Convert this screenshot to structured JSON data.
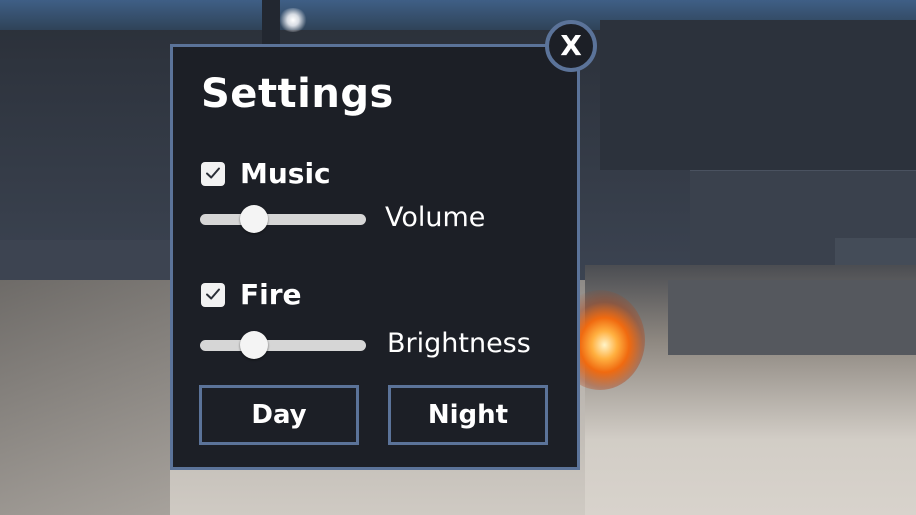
{
  "window": {
    "title": "Settings",
    "close_label": "X"
  },
  "music": {
    "label": "Music",
    "checked": true,
    "slider_label": "Volume",
    "slider_value": 0.29
  },
  "fire": {
    "label": "Fire",
    "checked": true,
    "slider_label": "Brightness",
    "slider_value": 0.29
  },
  "buttons": {
    "day_label": "Day",
    "night_label": "Night"
  },
  "colors": {
    "panel_bg": "#1c1f26",
    "panel_border": "#5b7399",
    "text": "#ffffff"
  },
  "icons": {
    "close": "close-icon",
    "check": "checkmark-icon"
  }
}
